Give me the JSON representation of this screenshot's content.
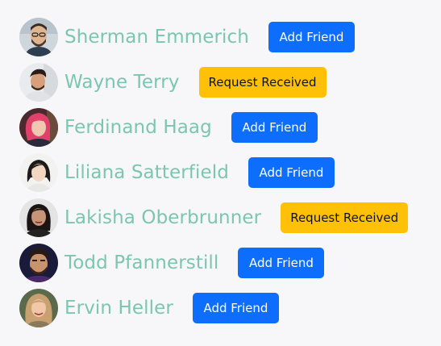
{
  "friends": [
    {
      "name": "Sherman Emmerich",
      "action": "Add Friend",
      "status": "add"
    },
    {
      "name": "Wayne Terry",
      "action": "Request Received",
      "status": "received"
    },
    {
      "name": "Ferdinand Haag",
      "action": "Add Friend",
      "status": "add"
    },
    {
      "name": "Liliana Satterfield",
      "action": "Add Friend",
      "status": "add"
    },
    {
      "name": "Lakisha Oberbrunner",
      "action": "Request Received",
      "status": "received"
    },
    {
      "name": "Todd Pfannerstill",
      "action": "Add Friend",
      "status": "add"
    },
    {
      "name": "Ervin Heller",
      "action": "Add Friend",
      "status": "add"
    }
  ],
  "colors": {
    "name_text": "#7cc6ad",
    "add_button": "#0d6efd",
    "received_button": "#ffc107",
    "background": "#f7f7f9"
  }
}
